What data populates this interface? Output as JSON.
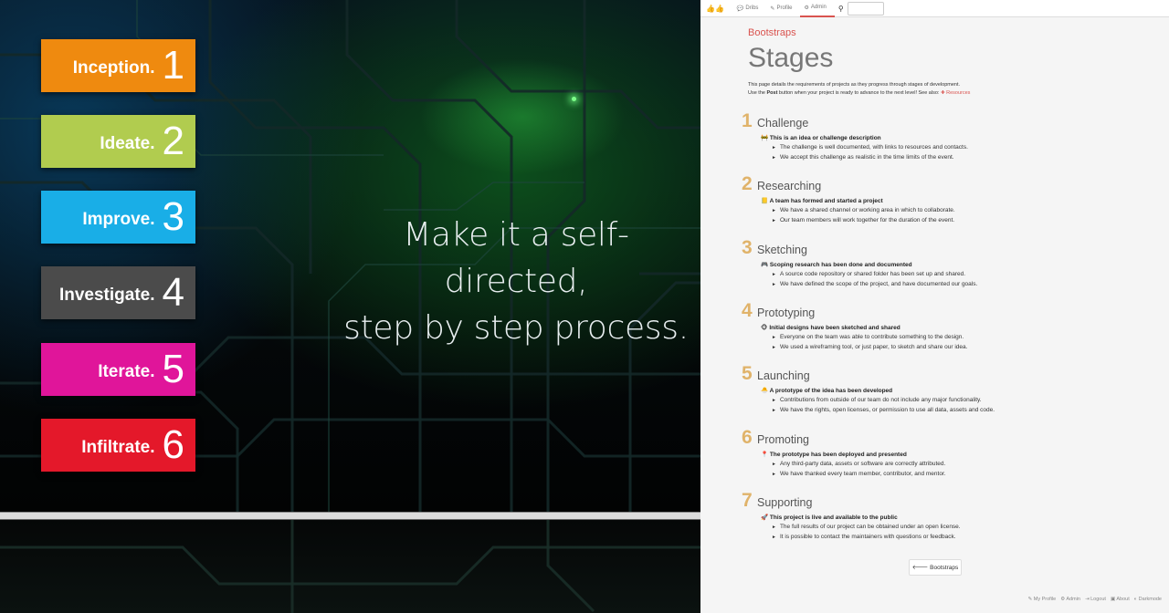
{
  "slide": {
    "stages": [
      {
        "label": "Inception.",
        "num": "1",
        "color": "#ef8a0f"
      },
      {
        "label": "Ideate.",
        "num": "2",
        "color": "#b1cc4f"
      },
      {
        "label": "Improve.",
        "num": "3",
        "color": "#19aee7"
      },
      {
        "label": "Investigate.",
        "num": "4",
        "color": "#4b4b4b"
      },
      {
        "label": "Iterate.",
        "num": "5",
        "color": "#e0159a"
      },
      {
        "label": "Infiltrate.",
        "num": "6",
        "color": "#e4182a"
      }
    ],
    "quote_line1": "Make it a self-directed,",
    "quote_line2": "step by step process."
  },
  "nav": {
    "brand_icon": "thumbs-up-icon",
    "items": [
      {
        "label": "Dribs",
        "icon": "comment-icon"
      },
      {
        "label": "Profile",
        "icon": "user-icon"
      },
      {
        "label": "Admin",
        "icon": "gear-icon"
      }
    ],
    "search_placeholder": ""
  },
  "page": {
    "breadcrumb": "Bootstraps",
    "title": "Stages",
    "intro_line1": "This page details the requirements of projects as they progress through stages of development.",
    "intro_line2a": "Use the ",
    "intro_post": "Post",
    "intro_line2b": " button when your project is ready to advance to the next level! See also: ",
    "intro_resources": "Resources",
    "stages": [
      {
        "num": "1",
        "name": "Challenge",
        "icon": "🚧",
        "requirement": "This is an idea or challenge description",
        "items": [
          "The challenge is well documented, with links to resources and contacts.",
          "We accept this challenge as realistic in the time limits of the event."
        ]
      },
      {
        "num": "2",
        "name": "Researching",
        "icon": "📒",
        "requirement": "A team has formed and started a project",
        "items": [
          "We have a shared channel or working area in which to collaborate.",
          "Our team members will work together for the duration of the event."
        ]
      },
      {
        "num": "3",
        "name": "Sketching",
        "icon": "🎮",
        "requirement": "Scoping research has been done and documented",
        "items": [
          "A source code repository or shared folder has been set up and shared.",
          "We have defined the scope of the project, and have documented our goals."
        ]
      },
      {
        "num": "4",
        "name": "Prototyping",
        "icon": "🐵",
        "requirement": "Initial designs have been sketched and shared",
        "items": [
          "Everyone on the team was able to contribute something to the design.",
          "We used a wireframing tool, or just paper, to sketch and share our idea."
        ]
      },
      {
        "num": "5",
        "name": "Launching",
        "icon": "🐣",
        "requirement": "A prototype of the idea has been developed",
        "items": [
          "Contributions from outside of our team do not include any major functionality.",
          "We have the rights, open licenses, or permission to use all data, assets and code."
        ]
      },
      {
        "num": "6",
        "name": "Promoting",
        "icon": "📍",
        "requirement": "The prototype has been deployed and presented",
        "items": [
          "Any third-party data, assets or software are correctly attributed.",
          "We have thanked every team member, contributor, and mentor."
        ]
      },
      {
        "num": "7",
        "name": "Supporting",
        "icon": "🚀",
        "requirement": "This project is live and available to the public",
        "items": [
          "The full results of our project can be obtained under an open license.",
          "It is possible to contact the maintainers with questions or feedback."
        ]
      }
    ],
    "back_button": "Bootstraps",
    "footer": [
      {
        "label": "My Profile",
        "icon": "user-icon"
      },
      {
        "label": "Admin",
        "icon": "gear-icon"
      },
      {
        "label": "Logout",
        "icon": "logout-icon"
      },
      {
        "label": "About",
        "icon": "info-icon"
      },
      {
        "label": "Darkmode",
        "icon": "contrast-icon"
      }
    ]
  }
}
